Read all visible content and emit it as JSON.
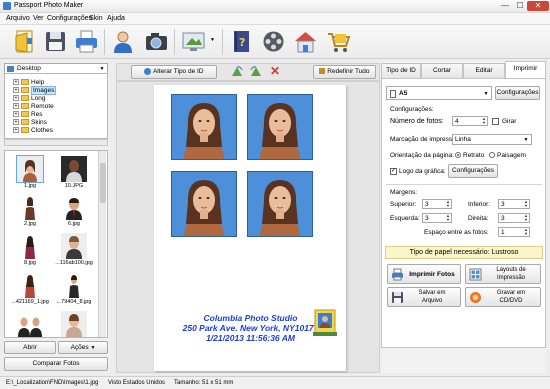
{
  "window": {
    "title": "Passport Photo Maker",
    "minimize": "—",
    "maximize": "☐",
    "close": "✕"
  },
  "menu": [
    "Arquivo",
    "Ver",
    "Configurações",
    "Skin",
    "Ajuda"
  ],
  "toolbar_icons": [
    "open-icon",
    "save-icon",
    "print-icon",
    "user-icon",
    "camera-icon",
    "screen-capture-icon",
    "book-icon",
    "film-reel-icon",
    "home-icon",
    "cart-icon"
  ],
  "left": {
    "drive": "Desktop",
    "tree": [
      "Help",
      "Images",
      "Long",
      "Remote",
      "Res",
      "Skins",
      "Clothes"
    ],
    "selected_folder": "Images",
    "thumbnails": [
      "1.jpg",
      "10.JPG",
      "2.jpg",
      "6.jpg",
      "8.jpg",
      "...116ab100.jpg",
      "...421169_1.jpg",
      "...79404_8.jpg",
      "",
      ""
    ],
    "open_button": "Abrir",
    "actions_button": "Ações",
    "compare_button": "Comparar Fotos"
  },
  "center": {
    "change_id_button": "Alterar Tipo de ID",
    "reset_button": "Redefinir Tudo",
    "studio": {
      "line1": "Columbia Photo Studio",
      "line2": "250 Park Ave. New York, NY10177",
      "line3": "1/21/2013 11:56:36 AM"
    }
  },
  "right": {
    "tabs": [
      "Tipo de ID",
      "Cortar",
      "Editar",
      "Imprimir"
    ],
    "active_tab": "Imprimir",
    "paper_size": "A5",
    "paper_config_button": "Configurações",
    "settings_header": "Configurações:",
    "num_photos_label": "Número de fotos:",
    "num_photos": "4",
    "rotate_label": "Girar",
    "cut_marks_label": "Marcação de impressão",
    "cut_marks_value": "Linha",
    "orientation_label": "Orientação da página:",
    "portrait": "Retrato",
    "landscape": "Paisagem",
    "logo_label": "Logo da gráfica:",
    "logo_config_button": "Configurações",
    "margins_header": "Margens:",
    "top_label": "Superior:",
    "top": "3",
    "bottom_label": "Inferior:",
    "bottom": "3",
    "left_label": "Esquerda:",
    "left_val": "3",
    "right_label": "Direita:",
    "right_val": "3",
    "spacing_label": "Espaço entre as fotos:",
    "spacing": "1",
    "paper_type": "Tipo de papel necessário: Lustroso",
    "print_button": "Imprimir Fotos",
    "layouts_button_1": "Layouts de",
    "layouts_button_2": "Impressão",
    "save_button_1": "Salvar em",
    "save_button_2": "Arquivo",
    "burn_button_1": "Gravar em",
    "burn_button_2": "CD/DVD"
  },
  "status": {
    "path": "E:\\_Localization\\FND\\Images\\1.jpg",
    "id_type": "Visto Estados Unidos",
    "size": "Tamanho: 51 x 51 mm"
  }
}
